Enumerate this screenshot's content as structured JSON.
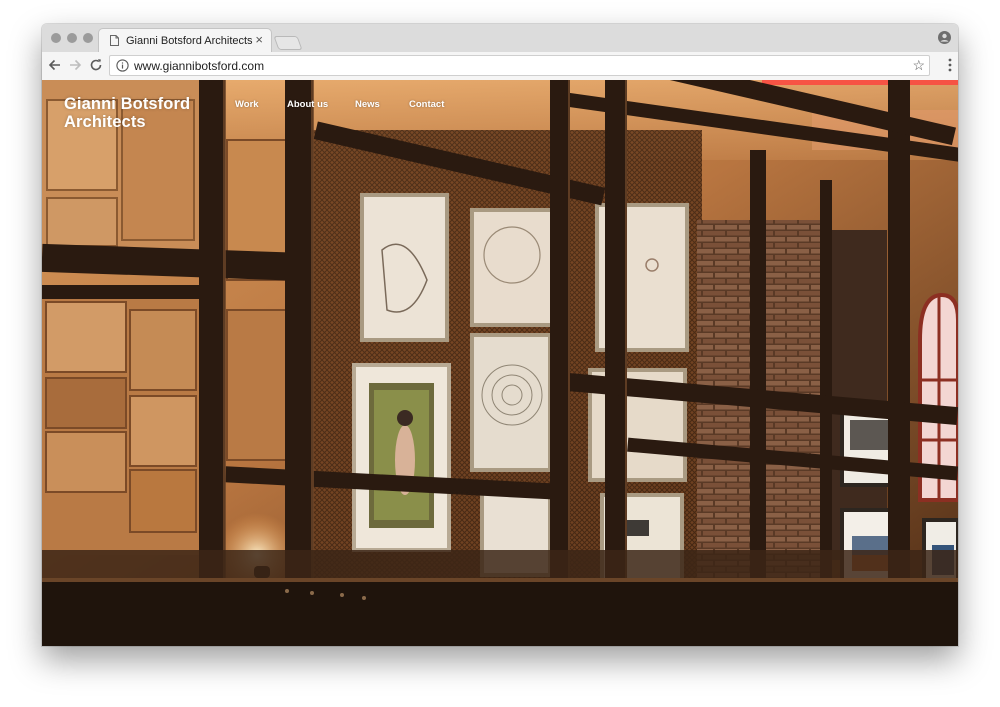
{
  "browser": {
    "tab_title": "Gianni Botsford Architects",
    "tab_close": "×",
    "url": "www.giannibotsford.com",
    "bookmark_star": "☆",
    "icons": {
      "tab": "document-icon",
      "close": "close-icon",
      "new_tab": "new-tab-icon",
      "profile": "profile-icon",
      "back": "back-arrow-icon",
      "forward": "forward-arrow-icon",
      "reload": "reload-icon",
      "site_info": "info-icon",
      "bookmark": "star-icon",
      "menu": "kebab-menu-icon"
    }
  },
  "site": {
    "logo_line1": "Gianni Botsford",
    "logo_line2": "Architects",
    "nav": [
      {
        "label": "Work"
      },
      {
        "label": "About us"
      },
      {
        "label": "News"
      },
      {
        "label": "Contact"
      }
    ],
    "hero_image": "photograph-of-interior-gallery-behind-steel-window-frame"
  },
  "colors": {
    "tab_bar": "#dcdcdc",
    "toolbar": "#f5f5f5",
    "nav_text": "#ffffff",
    "hero_warm": "#c9874d",
    "hero_frame": "#2b1a10"
  }
}
